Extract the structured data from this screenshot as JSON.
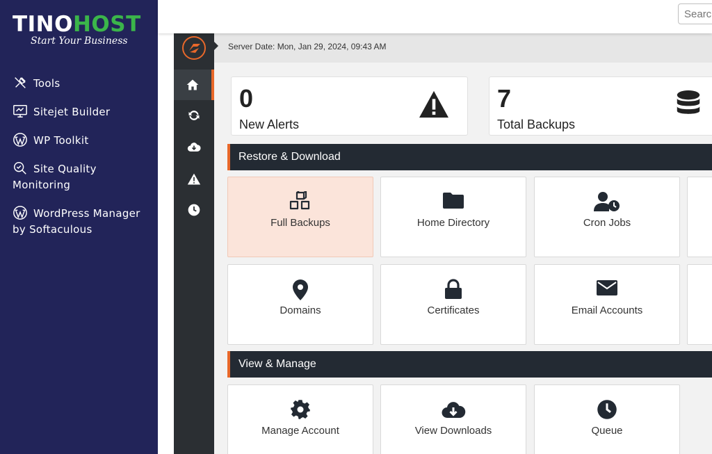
{
  "brand": {
    "name_part1": "TINO",
    "name_part2": "HOST",
    "tagline": "Start Your Business"
  },
  "sidebar": {
    "items": [
      {
        "label": "Tools",
        "icon": "tools-icon"
      },
      {
        "label": "Sitejet Builder",
        "icon": "sitejet-icon"
      },
      {
        "label": "WP Toolkit",
        "icon": "wordpress-icon"
      },
      {
        "label": "Site Quality Monitoring",
        "icon": "site-quality-icon"
      },
      {
        "label": "WordPress Manager by Softaculous",
        "icon": "wordpress-icon"
      }
    ]
  },
  "topbar": {
    "search_placeholder": "Search"
  },
  "rail": {
    "items": [
      "home-icon",
      "refresh-icon",
      "cloud-download-icon",
      "warning-icon",
      "clock-icon"
    ],
    "active_index": 0
  },
  "breadcrumb": {
    "server_date": "Server Date: Mon, Jan 29, 2024, 09:43 AM"
  },
  "stats": [
    {
      "value": "0",
      "label": "New Alerts",
      "icon": "warning-icon"
    },
    {
      "value": "7",
      "label": "Total Backups",
      "icon": "database-icon"
    }
  ],
  "sections": [
    {
      "title": "Restore & Download",
      "tiles": [
        {
          "label": "Full Backups",
          "icon": "cubes-icon",
          "active": true
        },
        {
          "label": "Home Directory",
          "icon": "folder-icon"
        },
        {
          "label": "Cron Jobs",
          "icon": "user-clock-icon"
        },
        {
          "label": "Domains",
          "icon": "map-pin-icon"
        },
        {
          "label": "Certificates",
          "icon": "lock-icon"
        },
        {
          "label": "Email Accounts",
          "icon": "envelope-icon"
        }
      ]
    },
    {
      "title": "View & Manage",
      "tiles": [
        {
          "label": "Manage Account",
          "icon": "gear-icon"
        },
        {
          "label": "View Downloads",
          "icon": "cloud-download-icon"
        },
        {
          "label": "Queue",
          "icon": "clock-icon"
        }
      ]
    }
  ],
  "colors": {
    "sidebar_bg": "#222459",
    "accent": "#e8682a",
    "brand_green": "#3bb54a",
    "rail_bg": "#2b2f33",
    "section_bg": "#232a33",
    "active_tile_bg": "#fbe4da"
  }
}
